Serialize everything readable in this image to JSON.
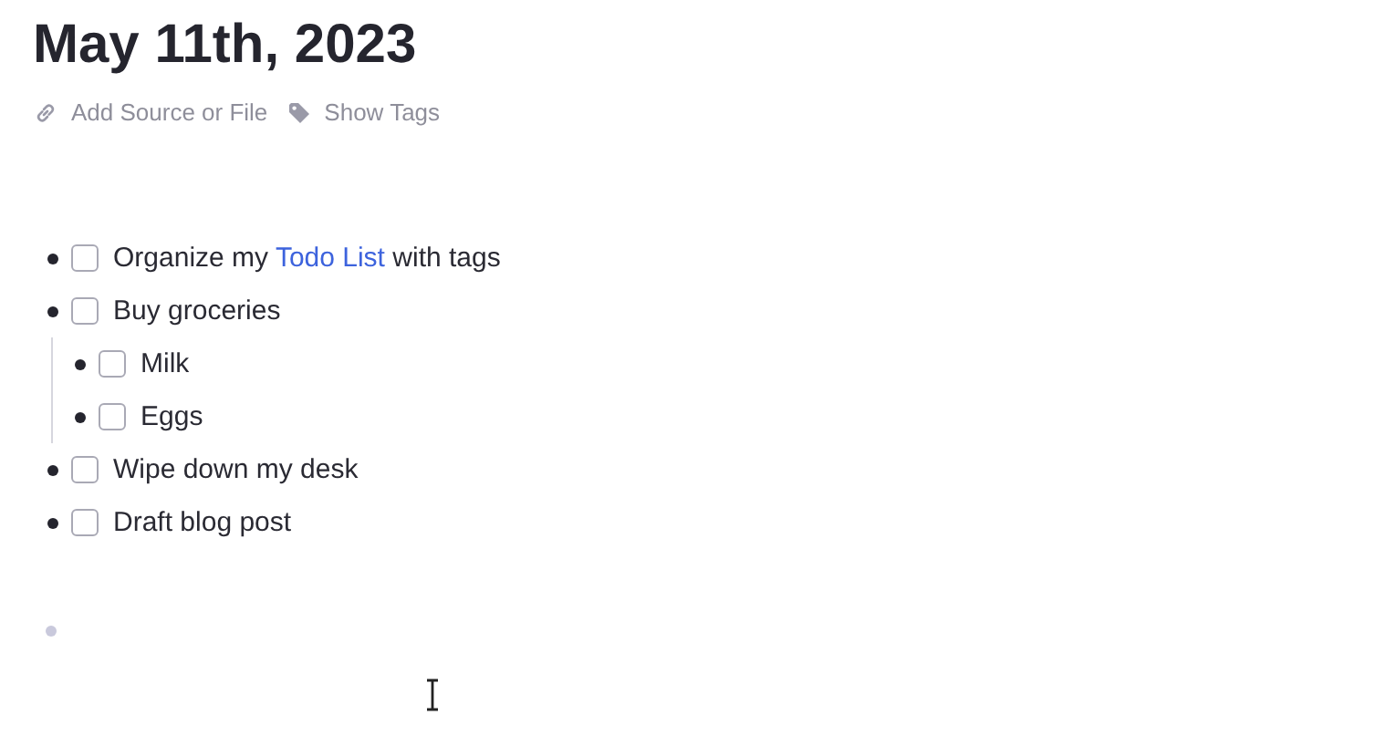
{
  "page": {
    "title": "May 11th, 2023"
  },
  "actions": [
    {
      "kind": "source",
      "label": "Add Source or File"
    },
    {
      "kind": "tags",
      "label": "Show Tags"
    }
  ],
  "blocks": [
    {
      "checked": false,
      "parts": [
        {
          "kind": "text",
          "text": "Organize my "
        },
        {
          "kind": "link",
          "text": "Todo List"
        },
        {
          "kind": "text",
          "text": " with tags"
        }
      ]
    },
    {
      "checked": false,
      "parts": [
        {
          "kind": "text",
          "text": "Buy groceries"
        }
      ],
      "children": [
        {
          "checked": false,
          "parts": [
            {
              "kind": "text",
              "text": "Milk"
            }
          ]
        },
        {
          "checked": false,
          "parts": [
            {
              "kind": "text",
              "text": "Eggs"
            }
          ]
        }
      ]
    },
    {
      "checked": false,
      "parts": [
        {
          "kind": "text",
          "text": "Wipe down my desk"
        }
      ]
    },
    {
      "checked": false,
      "parts": [
        {
          "kind": "text",
          "text": "Draft blog post"
        }
      ]
    }
  ],
  "trailing_empty_block": true
}
